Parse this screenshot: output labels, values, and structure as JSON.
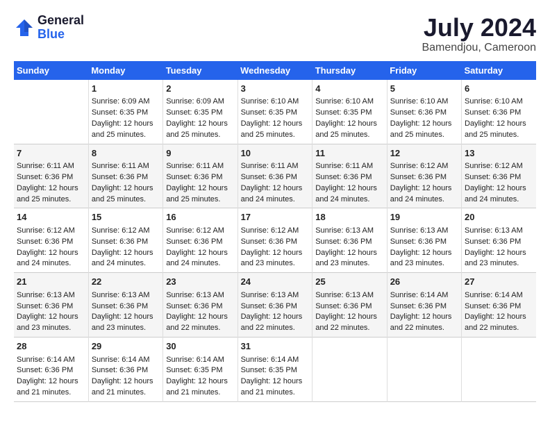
{
  "header": {
    "logo_general": "General",
    "logo_blue": "Blue",
    "month_title": "July 2024",
    "location": "Bamendjou, Cameroon"
  },
  "days_of_week": [
    "Sunday",
    "Monday",
    "Tuesday",
    "Wednesday",
    "Thursday",
    "Friday",
    "Saturday"
  ],
  "weeks": [
    [
      {
        "day": "",
        "content": ""
      },
      {
        "day": "1",
        "content": "Sunrise: 6:09 AM\nSunset: 6:35 PM\nDaylight: 12 hours and 25 minutes."
      },
      {
        "day": "2",
        "content": "Sunrise: 6:09 AM\nSunset: 6:35 PM\nDaylight: 12 hours and 25 minutes."
      },
      {
        "day": "3",
        "content": "Sunrise: 6:10 AM\nSunset: 6:35 PM\nDaylight: 12 hours and 25 minutes."
      },
      {
        "day": "4",
        "content": "Sunrise: 6:10 AM\nSunset: 6:35 PM\nDaylight: 12 hours and 25 minutes."
      },
      {
        "day": "5",
        "content": "Sunrise: 6:10 AM\nSunset: 6:36 PM\nDaylight: 12 hours and 25 minutes."
      },
      {
        "day": "6",
        "content": "Sunrise: 6:10 AM\nSunset: 6:36 PM\nDaylight: 12 hours and 25 minutes."
      }
    ],
    [
      {
        "day": "7",
        "content": "Sunrise: 6:11 AM\nSunset: 6:36 PM\nDaylight: 12 hours and 25 minutes."
      },
      {
        "day": "8",
        "content": "Sunrise: 6:11 AM\nSunset: 6:36 PM\nDaylight: 12 hours and 25 minutes."
      },
      {
        "day": "9",
        "content": "Sunrise: 6:11 AM\nSunset: 6:36 PM\nDaylight: 12 hours and 25 minutes."
      },
      {
        "day": "10",
        "content": "Sunrise: 6:11 AM\nSunset: 6:36 PM\nDaylight: 12 hours and 24 minutes."
      },
      {
        "day": "11",
        "content": "Sunrise: 6:11 AM\nSunset: 6:36 PM\nDaylight: 12 hours and 24 minutes."
      },
      {
        "day": "12",
        "content": "Sunrise: 6:12 AM\nSunset: 6:36 PM\nDaylight: 12 hours and 24 minutes."
      },
      {
        "day": "13",
        "content": "Sunrise: 6:12 AM\nSunset: 6:36 PM\nDaylight: 12 hours and 24 minutes."
      }
    ],
    [
      {
        "day": "14",
        "content": "Sunrise: 6:12 AM\nSunset: 6:36 PM\nDaylight: 12 hours and 24 minutes."
      },
      {
        "day": "15",
        "content": "Sunrise: 6:12 AM\nSunset: 6:36 PM\nDaylight: 12 hours and 24 minutes."
      },
      {
        "day": "16",
        "content": "Sunrise: 6:12 AM\nSunset: 6:36 PM\nDaylight: 12 hours and 24 minutes."
      },
      {
        "day": "17",
        "content": "Sunrise: 6:12 AM\nSunset: 6:36 PM\nDaylight: 12 hours and 23 minutes."
      },
      {
        "day": "18",
        "content": "Sunrise: 6:13 AM\nSunset: 6:36 PM\nDaylight: 12 hours and 23 minutes."
      },
      {
        "day": "19",
        "content": "Sunrise: 6:13 AM\nSunset: 6:36 PM\nDaylight: 12 hours and 23 minutes."
      },
      {
        "day": "20",
        "content": "Sunrise: 6:13 AM\nSunset: 6:36 PM\nDaylight: 12 hours and 23 minutes."
      }
    ],
    [
      {
        "day": "21",
        "content": "Sunrise: 6:13 AM\nSunset: 6:36 PM\nDaylight: 12 hours and 23 minutes."
      },
      {
        "day": "22",
        "content": "Sunrise: 6:13 AM\nSunset: 6:36 PM\nDaylight: 12 hours and 23 minutes."
      },
      {
        "day": "23",
        "content": "Sunrise: 6:13 AM\nSunset: 6:36 PM\nDaylight: 12 hours and 22 minutes."
      },
      {
        "day": "24",
        "content": "Sunrise: 6:13 AM\nSunset: 6:36 PM\nDaylight: 12 hours and 22 minutes."
      },
      {
        "day": "25",
        "content": "Sunrise: 6:13 AM\nSunset: 6:36 PM\nDaylight: 12 hours and 22 minutes."
      },
      {
        "day": "26",
        "content": "Sunrise: 6:14 AM\nSunset: 6:36 PM\nDaylight: 12 hours and 22 minutes."
      },
      {
        "day": "27",
        "content": "Sunrise: 6:14 AM\nSunset: 6:36 PM\nDaylight: 12 hours and 22 minutes."
      }
    ],
    [
      {
        "day": "28",
        "content": "Sunrise: 6:14 AM\nSunset: 6:36 PM\nDaylight: 12 hours and 21 minutes."
      },
      {
        "day": "29",
        "content": "Sunrise: 6:14 AM\nSunset: 6:36 PM\nDaylight: 12 hours and 21 minutes."
      },
      {
        "day": "30",
        "content": "Sunrise: 6:14 AM\nSunset: 6:35 PM\nDaylight: 12 hours and 21 minutes."
      },
      {
        "day": "31",
        "content": "Sunrise: 6:14 AM\nSunset: 6:35 PM\nDaylight: 12 hours and 21 minutes."
      },
      {
        "day": "",
        "content": ""
      },
      {
        "day": "",
        "content": ""
      },
      {
        "day": "",
        "content": ""
      }
    ]
  ]
}
